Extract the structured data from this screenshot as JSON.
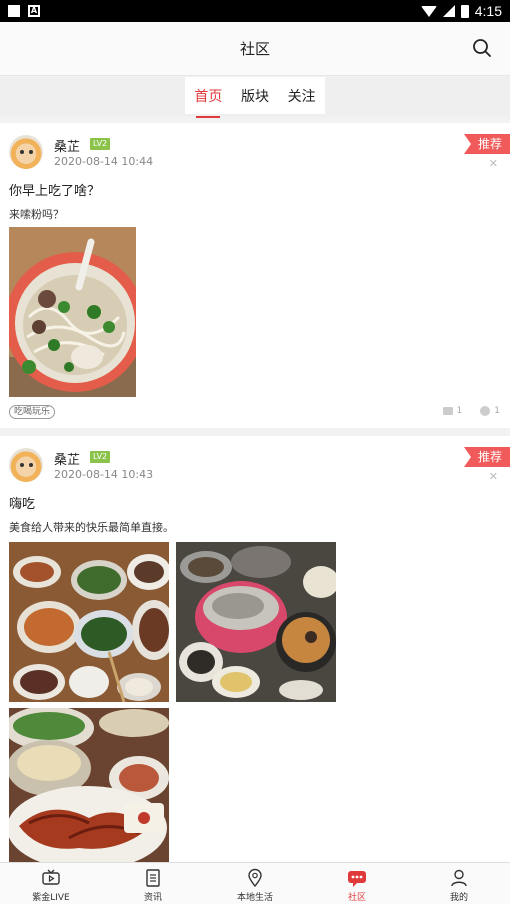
{
  "status_bar": {
    "time": "4:15"
  },
  "header": {
    "title": "社区"
  },
  "tabs": [
    {
      "label": "首页",
      "active": true
    },
    {
      "label": "版块",
      "active": false
    },
    {
      "label": "关注",
      "active": false
    }
  ],
  "posts": [
    {
      "username": "桑芷",
      "level": "LV2",
      "time": "2020-08-14 10:44",
      "badge": "推荐",
      "title": "你早上吃了啥？",
      "body": "来嗦粉吗？",
      "tag": "吃喝玩乐",
      "comments": "1",
      "views": "1"
    },
    {
      "username": "桑芷",
      "level": "LV2",
      "time": "2020-08-14 10:43",
      "badge": "推荐",
      "title": "嗨吃",
      "body": "美食给人带来的快乐最简单直接。"
    }
  ],
  "bottom_nav": [
    {
      "label": "紫金LIVE",
      "icon": "tv-icon"
    },
    {
      "label": "资讯",
      "icon": "news-icon"
    },
    {
      "label": "本地生活",
      "icon": "location-icon"
    },
    {
      "label": "社区",
      "icon": "chat-icon",
      "active": true
    },
    {
      "label": "我的",
      "icon": "user-icon"
    }
  ],
  "colors": {
    "accent": "#e03a3a",
    "badge": "#f05a5a",
    "level": "#8bc34a"
  }
}
